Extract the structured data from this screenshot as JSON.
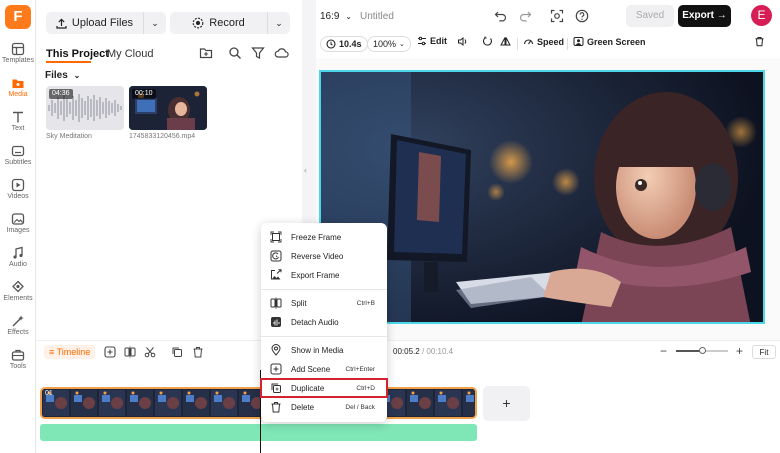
{
  "rail": {
    "logo": "F",
    "items": [
      {
        "label": "Templates",
        "icon": "templates-icon"
      },
      {
        "label": "Media",
        "icon": "media-icon"
      },
      {
        "label": "Text",
        "icon": "text-icon"
      },
      {
        "label": "Subtitles",
        "icon": "subtitles-icon"
      },
      {
        "label": "Videos",
        "icon": "videos-icon"
      },
      {
        "label": "Images",
        "icon": "images-icon"
      },
      {
        "label": "Audio",
        "icon": "audio-icon"
      },
      {
        "label": "Elements",
        "icon": "elements-icon"
      },
      {
        "label": "Effects",
        "icon": "effects-icon"
      },
      {
        "label": "Tools",
        "icon": "tools-icon"
      }
    ],
    "active": "Media"
  },
  "panel": {
    "upload_label": "Upload Files",
    "record_label": "Record",
    "tabs": [
      "This Project",
      "My Cloud"
    ],
    "files_label": "Files",
    "files": [
      {
        "duration": "04:36",
        "name": "Sky Meditation",
        "kind": "audio"
      },
      {
        "duration": "00:10",
        "name": "1745833120456.mp4",
        "kind": "video"
      }
    ]
  },
  "topbar": {
    "aspect": "16:9",
    "title": "Untitled",
    "saved_label": "Saved",
    "export_label": "Export",
    "avatar_letter": "E"
  },
  "tools": {
    "duration": "10.4s",
    "zoom": "100%",
    "edit": "Edit",
    "speed": "Speed",
    "green_screen": "Green Screen"
  },
  "timeline": {
    "label": "Timeline",
    "current_time": "00:05.2",
    "total_time": "00:10.4",
    "fit_label": "Fit",
    "clip_marker": "01"
  },
  "menu": {
    "items": [
      {
        "label": "Freeze Frame",
        "shortcut": "",
        "icon": "freeze-frame-icon"
      },
      {
        "label": "Reverse Video",
        "shortcut": "",
        "icon": "reverse-video-icon"
      },
      {
        "label": "Export Frame",
        "shortcut": "",
        "icon": "export-frame-icon"
      },
      {
        "label": "Split",
        "shortcut": "Ctrl+B",
        "icon": "split-icon"
      },
      {
        "label": "Detach Audio",
        "shortcut": "",
        "icon": "detach-audio-icon"
      },
      {
        "label": "Show in Media",
        "shortcut": "",
        "icon": "location-pin-icon"
      },
      {
        "label": "Add Scene",
        "shortcut": "Ctrl+Enter",
        "icon": "add-scene-icon"
      },
      {
        "label": "Duplicate",
        "shortcut": "Ctrl+D",
        "icon": "duplicate-icon"
      },
      {
        "label": "Delete",
        "shortcut": "Del / Back",
        "icon": "trash-icon"
      }
    ],
    "highlighted": "Duplicate"
  },
  "colors": {
    "accent": "#ff6a00",
    "selection_border": "#4dd6e8",
    "audio_track": "#7fe6b6",
    "highlight": "#d0232f",
    "avatar": "#d61e55"
  }
}
